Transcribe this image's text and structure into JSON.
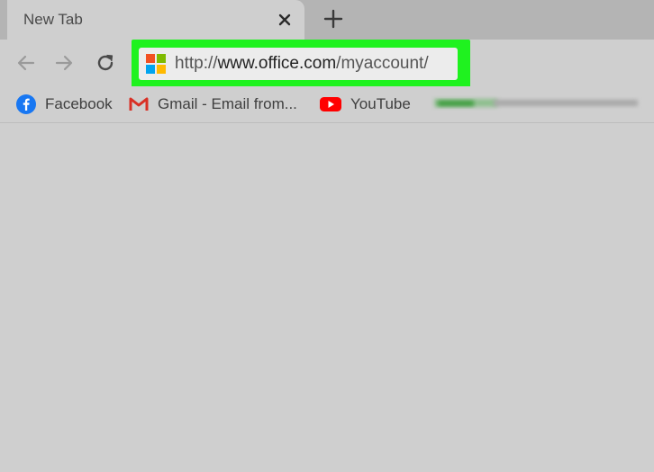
{
  "tab": {
    "title": "New Tab",
    "close_icon": "close-icon",
    "new_tab_icon": "plus-icon"
  },
  "toolbar": {
    "back_icon": "arrow-left-icon",
    "forward_icon": "arrow-right-icon",
    "reload_icon": "reload-icon",
    "address": {
      "favicon": "microsoft-logo-icon",
      "scheme": "http://",
      "host": "www.office.com",
      "path": "/myaccount/",
      "highlight_color": "#1ff21f"
    }
  },
  "bookmarks": [
    {
      "label": "Facebook",
      "icon": "facebook-icon",
      "color": "#1877f2"
    },
    {
      "label": "Gmail - Email from...",
      "icon": "gmail-icon",
      "color": "#d93025"
    },
    {
      "label": "YouTube",
      "icon": "youtube-icon",
      "color": "#ff0000"
    }
  ],
  "colors": {
    "ms_red": "#f25022",
    "ms_green": "#7fba00",
    "ms_blue": "#00a4ef",
    "ms_yellow": "#ffb900"
  }
}
